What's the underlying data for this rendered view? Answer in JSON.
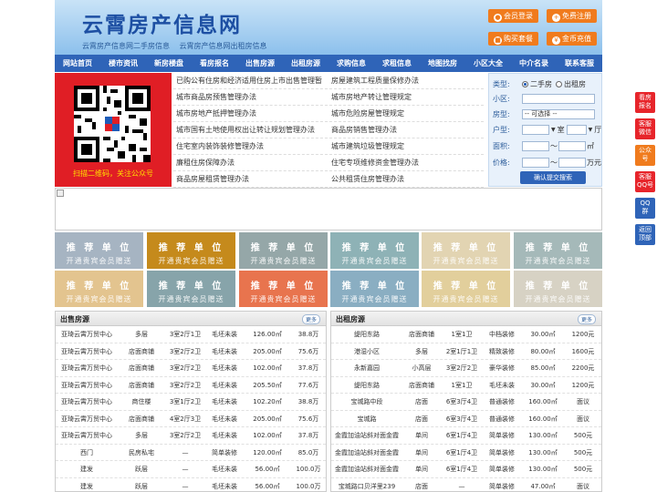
{
  "header": {
    "title": "云霄房产信息网",
    "subtitle_links": [
      "云霄房产信息网二手房信息",
      "云霄房产信息网出租房信息"
    ],
    "buttons": [
      "会员登录",
      "免费注册",
      "购买套餐",
      "金币充值"
    ]
  },
  "nav": [
    "网站首页",
    "楼市资讯",
    "新房楼盘",
    "看房报名",
    "出售房源",
    "出租房源",
    "求购信息",
    "求租信息",
    "地图找房",
    "小区大全",
    "中介名录",
    "联系客服"
  ],
  "qr": {
    "caption": "扫描二维码，关注公众号"
  },
  "links": [
    [
      "已购公有住房和经济适用住房上市出售管理暂",
      "房屋建筑工程质量保修办法"
    ],
    [
      "城市商品房预售管理办法",
      "城市房地产转让管理规定"
    ],
    [
      "城市房地产抵押管理办法",
      "城市危险房屋管理规定"
    ],
    [
      "城市国有土地使用权出让转让规划管理办法",
      "商品房销售管理办法"
    ],
    [
      "住宅室内装饰装修管理办法",
      "城市建筑垃圾管理规定"
    ],
    [
      "廉租住房保障办法",
      "住宅专项维修资金管理办法"
    ],
    [
      "商品房屋租赁管理办法",
      "公共租赁住房管理办法"
    ]
  ],
  "search": {
    "type_label": "类型:",
    "type_options": [
      "二手房",
      "出租房"
    ],
    "community_label": "小区:",
    "room_type_label": "房型:",
    "room_type_value": "-- 可选择 --",
    "layout_label": "户型:",
    "layout_room": "室",
    "layout_hall": "厅",
    "area_label": "面积:",
    "area_unit": "㎡",
    "range_sep": "～",
    "price_label": "价格:",
    "price_unit": "万元",
    "submit": "确认提交搜索"
  },
  "ads": {
    "title": "推 荐 单 位",
    "sub": "开通贵宾会员赠送",
    "colors": [
      "#a6b4c2",
      "#c58a1c",
      "#95a7a8",
      "#8eb2b6",
      "#e2d4b2",
      "#a5b9b9",
      "#e3c48f",
      "#87a4aa",
      "#e8744e",
      "#8aaec2",
      "#e2cf9c",
      "#d7d2c4"
    ]
  },
  "sale": {
    "title": "出售房源",
    "more": "更多",
    "rows": [
      [
        "亚琦云霄万贸中心",
        "多层",
        "3室2厅1卫",
        "毛坯未装",
        "126.00㎡",
        "38.8万"
      ],
      [
        "亚琦云霄万贸中心",
        "店面商铺",
        "3室2厅2卫",
        "毛坯未装",
        "205.00㎡",
        "75.6万"
      ],
      [
        "亚琦云霄万贸中心",
        "店面商铺",
        "3室2厅2卫",
        "毛坯未装",
        "102.00㎡",
        "37.8万"
      ],
      [
        "亚琦云霄万贸中心",
        "店面商铺",
        "3室2厅2卫",
        "毛坯未装",
        "205.50㎡",
        "77.6万"
      ],
      [
        "亚琦云霄万贸中心",
        "商住楼",
        "3室1厅2卫",
        "毛坯未装",
        "102.20㎡",
        "38.8万"
      ],
      [
        "亚琦云霄万贸中心",
        "店面商铺",
        "4室2厅3卫",
        "毛坯未装",
        "205.00㎡",
        "75.6万"
      ],
      [
        "亚琦云霄万贸中心",
        "多层",
        "3室2厅2卫",
        "毛坯未装",
        "102.00㎡",
        "37.8万"
      ],
      [
        "西门",
        "民房私宅",
        "—",
        "简单装修",
        "120.00㎡",
        "85.0万"
      ],
      [
        "建发",
        "跃层",
        "—",
        "毛坯未装",
        "56.00㎡",
        "100.0万"
      ],
      [
        "建发",
        "跃层",
        "—",
        "毛坯未装",
        "56.00㎡",
        "100.0万"
      ]
    ]
  },
  "rent": {
    "title": "出租房源",
    "more": "更多",
    "rows": [
      [
        "缇阳东路",
        "店面商铺",
        "1室1卫",
        "中档装修",
        "30.00㎡",
        "1200元"
      ],
      [
        "港湿小区",
        "多层",
        "2室1厅1卫",
        "精致装修",
        "80.00㎡",
        "1600元"
      ],
      [
        "永新嘉园",
        "小高层",
        "3室2厅2卫",
        "豪华装修",
        "85.00㎡",
        "2200元"
      ],
      [
        "缇阳东路",
        "店面商铺",
        "1室1卫",
        "毛坯未装",
        "30.00㎡",
        "1200元"
      ],
      [
        "宝城路中段",
        "店面",
        "6室3厅4卫",
        "普通装修",
        "160.00㎡",
        "面议"
      ],
      [
        "宝城路",
        "店面",
        "6室3厅4卫",
        "普通装修",
        "160.00㎡",
        "面议"
      ],
      [
        "金霞加油站斜对面金霞",
        "单间",
        "6室1厅4卫",
        "简单装修",
        "130.00㎡",
        "500元"
      ],
      [
        "金霞加油站斜对面金霞",
        "单间",
        "6室1厅4卫",
        "简单装修",
        "130.00㎡",
        "500元"
      ],
      [
        "金霞加油站斜对面金霞",
        "单间",
        "6室1厅4卫",
        "简单装修",
        "130.00㎡",
        "500元"
      ],
      [
        "宝城路口贝洋里239",
        "店面",
        "—",
        "简单装修",
        "47.00㎡",
        "面议"
      ]
    ]
  },
  "side": [
    [
      "看房",
      "报名"
    ],
    [
      "客服",
      "微信"
    ],
    [
      "公众",
      "号"
    ],
    [
      "客服",
      "QQ号"
    ],
    [
      "QQ",
      "群"
    ],
    [
      "返回",
      "顶部"
    ]
  ],
  "side_colors": [
    "#e7252b",
    "#e7252b",
    "#f07b1d",
    "#e7252b",
    "#2f64b8",
    "#2f64b8"
  ]
}
